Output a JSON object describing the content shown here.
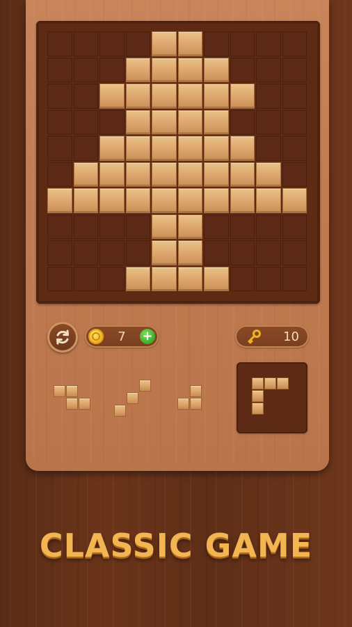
{
  "game": {
    "coins": "7",
    "keys": "10",
    "headline": "CLASSIC GAME",
    "board": {
      "rows": 10,
      "cols": 10,
      "filled_rows": [
        [
          4,
          5
        ],
        [
          3,
          4,
          5,
          6
        ],
        [
          2,
          3,
          4,
          5,
          6,
          7
        ],
        [
          3,
          4,
          5,
          6
        ],
        [
          2,
          3,
          4,
          5,
          6,
          7
        ],
        [
          1,
          2,
          3,
          4,
          5,
          6,
          7,
          8
        ],
        [
          0,
          1,
          2,
          3,
          4,
          5,
          6,
          7,
          8,
          9
        ],
        [
          4,
          5
        ],
        [
          4,
          5
        ],
        [
          3,
          4,
          5,
          6
        ]
      ]
    },
    "pieces": [
      {
        "name": "piece-1",
        "cells": [
          [
            0,
            0
          ],
          [
            0,
            1
          ],
          [
            1,
            1
          ],
          [
            1,
            2
          ]
        ]
      },
      {
        "name": "piece-2",
        "cells": [
          [
            0,
            2
          ],
          [
            1,
            1
          ],
          [
            2,
            0
          ]
        ]
      },
      {
        "name": "piece-3",
        "cells": [
          [
            0,
            1
          ],
          [
            1,
            0
          ],
          [
            1,
            1
          ]
        ]
      }
    ],
    "next_piece": {
      "cells": [
        [
          0,
          0
        ],
        [
          0,
          1
        ],
        [
          0,
          2
        ],
        [
          1,
          0
        ],
        [
          2,
          0
        ]
      ]
    }
  },
  "colors": {
    "background": "#5f2e17",
    "panel": "#c07a50",
    "board": "#5b2915",
    "block": "#dca56c",
    "headline": "#f3b552",
    "coin": "#f0b21e",
    "plus": "#3cab2b"
  },
  "icons": {
    "refresh": "refresh-icon",
    "coin": "coin-icon",
    "plus": "plus-icon",
    "key": "key-icon"
  }
}
